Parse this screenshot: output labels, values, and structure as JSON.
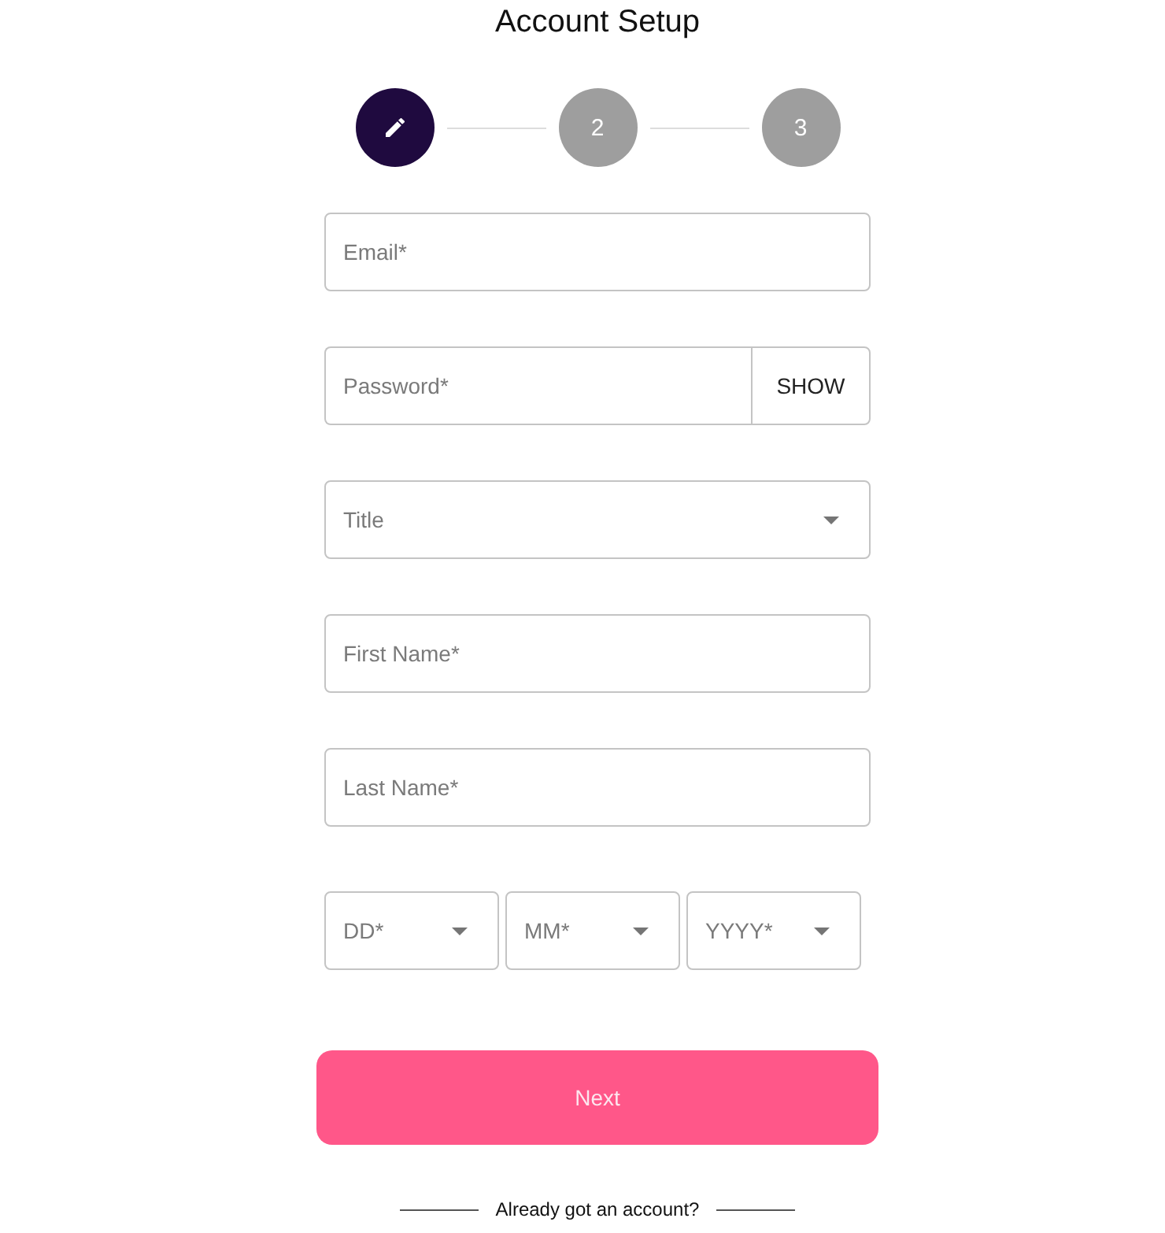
{
  "title": "Account Setup",
  "steps": [
    {
      "kind": "icon",
      "selected": true
    },
    {
      "kind": "number",
      "label": "2",
      "selected": false
    },
    {
      "kind": "number",
      "label": "3",
      "selected": false
    }
  ],
  "fields": [
    {
      "kind": "text",
      "placeholder": "Email*"
    },
    {
      "kind": "password",
      "placeholder": "Password*",
      "toggle": "SHOW"
    },
    {
      "kind": "select",
      "placeholder": "Title"
    },
    {
      "kind": "text",
      "placeholder": "First Name*"
    },
    {
      "kind": "text",
      "placeholder": "Last Name*"
    }
  ],
  "date_of_birth": [
    {
      "placeholder": "DD*"
    },
    {
      "placeholder": "MM*"
    },
    {
      "placeholder": "YYYY*"
    }
  ],
  "next_button": "Next",
  "login_prompt": "Already got an account?"
}
